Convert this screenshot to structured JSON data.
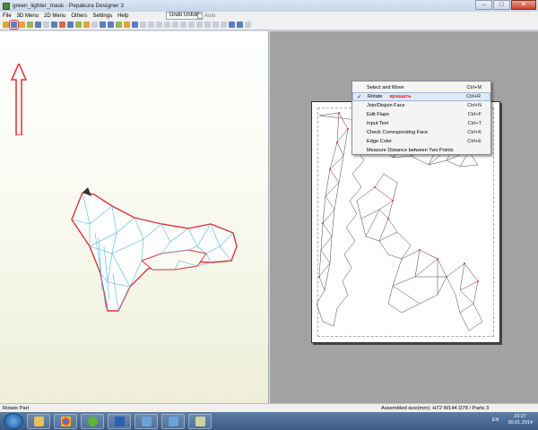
{
  "window": {
    "title": "green_lighter_mask - Pepakura Designer 3",
    "min": "–",
    "max": "□",
    "close": "✕"
  },
  "menu": {
    "items": [
      "File",
      "3D Menu",
      "2D Menu",
      "Others",
      "Settings",
      "Help"
    ],
    "undo_unfold": "Undo Unfold",
    "auto": "Auto"
  },
  "context_menu": {
    "items": [
      {
        "label": "Select and Move",
        "shortcut": "Ctrl+M",
        "checked": false,
        "note": ""
      },
      {
        "label": "Rotate",
        "shortcut": "Ctrl+R",
        "checked": true,
        "note": "вращать"
      },
      {
        "label": "Join/Disjoin Face",
        "shortcut": "Ctrl+N",
        "checked": false,
        "note": ""
      },
      {
        "label": "Edit Flaps",
        "shortcut": "Ctrl+F",
        "checked": false,
        "note": ""
      },
      {
        "label": "Input Text",
        "shortcut": "Ctrl+T",
        "checked": false,
        "note": ""
      },
      {
        "label": "Check Corresponding Face",
        "shortcut": "Ctrl+K",
        "checked": false,
        "note": ""
      },
      {
        "label": "Edge Color",
        "shortcut": "Ctrl+E",
        "checked": false,
        "note": ""
      },
      {
        "label": "Measure Distance between Two Points",
        "shortcut": "",
        "checked": false,
        "note": ""
      }
    ]
  },
  "status": {
    "left": "Rotate Part",
    "right": "Assembled size(mm): H72 W144 D78 / Parts 3"
  },
  "taskbar": {
    "lang": "EN",
    "time": "23:27",
    "date": "30.01.2014"
  },
  "colors": {
    "highlight_red": "#e03030",
    "mesh_blue": "#4fb3d9"
  }
}
